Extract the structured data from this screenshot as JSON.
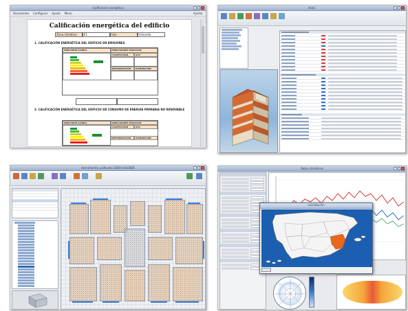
{
  "panel1": {
    "window_title": "Calificación energética",
    "menu_items": [
      "Documento",
      "Configurar",
      "Ayuda",
      "Menú"
    ],
    "zoom_label": "Ajustar",
    "doc_title": "Calificación energética del edificio",
    "header_fields": [
      "Zona climática",
      "E1",
      "Uso",
      "Vivienda"
    ],
    "section1": "1. CALIFICACIÓN ENERGÉTICA DEL EDIFICIO EN EMISIONES",
    "table1_headers": [
      "INDICADOR GLOBAL",
      "INDICADORES PARCIALES",
      "CALEFACCIÓN",
      "ACS",
      "REFRIGERACIÓN",
      "ILUMINACIÓN"
    ],
    "section2": "2. CALIFICACIÓN ENERGÉTICA DEL EDIFICIO EN CONSUMO DE ENERGÍA PRIMARIA NO RENOVABLE",
    "energy_colors": [
      "#009a3d",
      "#55b032",
      "#c3d52a",
      "#fff200",
      "#f7b417",
      "#ea6a25",
      "#e31d24"
    ]
  },
  "panel2": {
    "window_title": "HULC",
    "grid_sections": [
      "Espacios",
      "Recintos",
      "Resultados"
    ]
  },
  "panel3": {
    "window_title": "Herramienta unificada LIDER-CALENER"
  },
  "panel4": {
    "window_title": "Datos climáticos",
    "map_title": "Localización",
    "chart_colors": [
      "#d23a3a",
      "#2a6fc9",
      "#3aa052"
    ]
  }
}
